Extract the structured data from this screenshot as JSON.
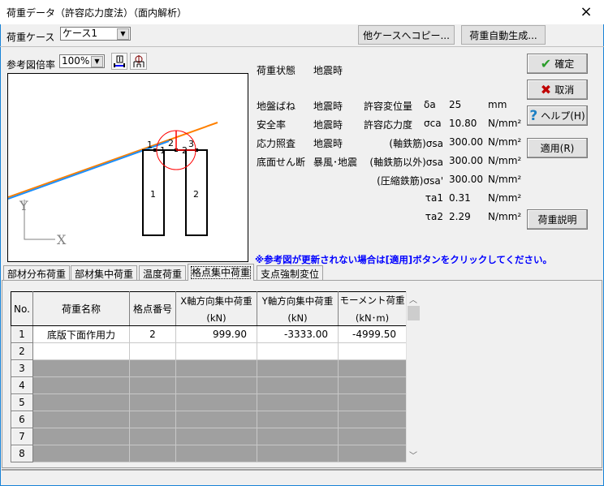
{
  "window": {
    "title": "荷重データ（許容応力度法）（面内解析）",
    "close_icon": "×"
  },
  "toolbar": {
    "case_label": "荷重ケース",
    "case_value": "ケース1",
    "copy_button": "他ケースへコピー...",
    "autogen_button": "荷重自動生成..."
  },
  "figure": {
    "scale_label": "参考図倍率",
    "scale_value": "100%",
    "labels": {
      "node1": "1",
      "node2": "2",
      "node3": "3",
      "member1": "1",
      "member2": "2",
      "col1": "1",
      "col2": "2",
      "y_axis": "Y",
      "x_axis": "X"
    }
  },
  "info": {
    "load_state_label": "荷重状態",
    "load_state_value": "地震時",
    "rows": [
      {
        "label": "地盤ばね",
        "value": "地震時",
        "name": "許容変位量",
        "symbol": "δa",
        "amount": "25",
        "unit": "mm"
      },
      {
        "label": "安全率",
        "value": "地震時",
        "name": "許容応力度",
        "symbol": "σca",
        "amount": "10.80",
        "unit": "N/mm²"
      },
      {
        "label": "応力照査",
        "value": "地震時",
        "name": "(軸鉄筋)σsa",
        "symbol": "",
        "amount": "300.00",
        "unit": "N/mm²"
      },
      {
        "label": "底面せん断",
        "value": "暴風･地震",
        "name": "(軸鉄筋以外)σsa",
        "symbol": "",
        "amount": "300.00",
        "unit": "N/mm²"
      },
      {
        "label": "",
        "value": "",
        "name": "(圧縮鉄筋)σsa'",
        "symbol": "",
        "amount": "300.00",
        "unit": "N/mm²"
      },
      {
        "label": "",
        "value": "",
        "name": "τa1",
        "symbol": "",
        "amount": "0.31",
        "unit": "N/mm²"
      },
      {
        "label": "",
        "value": "",
        "name": "τa2",
        "symbol": "",
        "amount": "2.29",
        "unit": "N/mm²"
      }
    ],
    "note": "※参考図が更新されない場合は[適用]ボタンをクリックしてください。"
  },
  "buttons": {
    "ok": "確定",
    "cancel": "取消",
    "help": "ヘルプ(H)",
    "apply": "適用(R)",
    "explain": "荷重説明"
  },
  "tabs": [
    "部材分布荷重",
    "部材集中荷重",
    "温度荷重",
    "格点集中荷重",
    "支点強制変位"
  ],
  "table": {
    "headers": [
      "No.",
      "荷重名称",
      "格点番号",
      "X軸方向集中荷重",
      "Y軸方向集中荷重",
      "モーメント荷重"
    ],
    "units": [
      "",
      "",
      "",
      "(kN)",
      "(kN)",
      "(kN･m)"
    ],
    "rows": [
      {
        "no": "1",
        "name": "底版下面作用力",
        "node": "2",
        "fx": "999.90",
        "fy": "-3333.00",
        "m": "-4999.50"
      },
      {
        "no": "2"
      },
      {
        "no": "3"
      },
      {
        "no": "4"
      },
      {
        "no": "5"
      },
      {
        "no": "6"
      },
      {
        "no": "7"
      },
      {
        "no": "8"
      }
    ]
  },
  "colors": {
    "accent_blue": "#1883d7",
    "note_blue": "#0000ff",
    "beam_orange": "#ff8000",
    "beam_blue": "#1e90ff",
    "load_red": "#ff0000"
  }
}
